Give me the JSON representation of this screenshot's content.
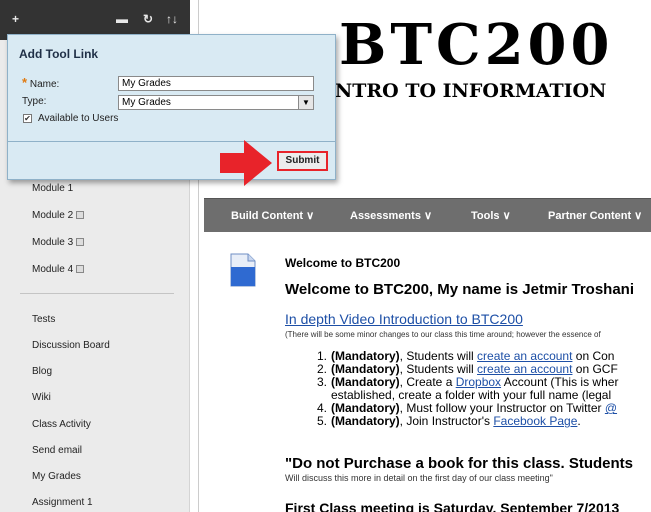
{
  "toolbar": {
    "add_glyph": "+",
    "folder_glyph": "▬",
    "refresh_glyph": "↻",
    "sort_glyph": "↑↓"
  },
  "course_menu": {
    "modules": [
      {
        "label": "Module 1",
        "icon": ""
      },
      {
        "label": "Module 2",
        "icon": "hidden-icon"
      },
      {
        "label": "Module 3",
        "icon": "hidden-icon"
      },
      {
        "label": "Module 4",
        "icon": "hidden-icon"
      }
    ],
    "items": [
      "Tests",
      "Discussion Board",
      "Blog",
      "Wiki",
      "Class Activity",
      "Send email",
      "My Grades",
      "Assignment 1"
    ]
  },
  "banner": {
    "title": "BTC200",
    "subtitle": "INTRO TO INFORMATION"
  },
  "navbar": {
    "items": [
      "Build Content ∨",
      "Assessments ∨",
      "Tools ∨",
      "Partner Content ∨"
    ]
  },
  "content": {
    "welcome_small": "Welcome to BTC200",
    "welcome_big": "Welcome to BTC200, My name is Jetmir Troshani",
    "video_link": "In depth Video Introduction to BTC200",
    "video_note": "(There will be some minor changes to our class this time around; however the essence of",
    "steps": [
      {
        "num": "1.",
        "bold": "(Mandatory)",
        "text": ", Students will ",
        "link": "create an account",
        "tail": " on Con"
      },
      {
        "num": "2.",
        "bold": "(Mandatory)",
        "text": ", Students will ",
        "link": "create an account",
        "tail": " on GCF"
      },
      {
        "num": "3.",
        "bold": "(Mandatory)",
        "text": ", Create a ",
        "link": "Dropbox",
        "tail": " Account (This is wher"
      },
      {
        "num": "",
        "bold": "",
        "text": "established, create a folder with your full name (legal",
        "link": "",
        "tail": ""
      },
      {
        "num": "4.",
        "bold": "(Mandatory)",
        "text": ", Must follow your Instructor on Twitter ",
        "link": "@",
        "tail": ""
      },
      {
        "num": "5.",
        "bold": "(Mandatory)",
        "text": ", Join Instructor's ",
        "link": "Facebook Page",
        "tail": "."
      }
    ],
    "purchase": "\"Do not Purchase a book for this class. Students",
    "purchase_note": "Will discuss this more in detail on the first day of our class meeting\"",
    "first_class": "First Class meeting is Saturday, September 7/2013"
  },
  "popup": {
    "title": "Add Tool Link",
    "required_mark": "*",
    "name_label": "Name:",
    "name_value": "My Grades",
    "type_label": "Type:",
    "type_value": "My Grades",
    "available_label": "Available to Users",
    "available_checked": "✔",
    "submit_label": "Submit"
  },
  "colors": {
    "toolbar_bg": "#333333",
    "popup_bg": "#d9eaf3",
    "navbar_bg": "#6e6e6e",
    "link": "#1d4fa6",
    "highlight_red": "#e8232a"
  }
}
